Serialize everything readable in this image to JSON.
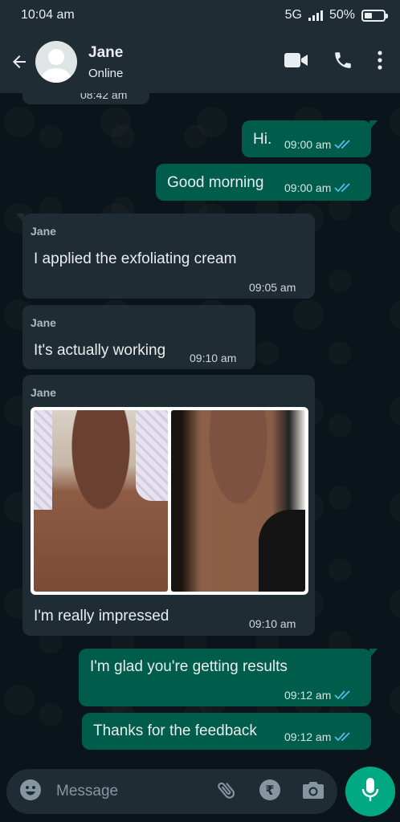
{
  "status_bar": {
    "time": "10:04 am",
    "network": "5G",
    "battery": "50%",
    "battery_level": 0.5
  },
  "header": {
    "name": "Jane",
    "status": "Online"
  },
  "chat": {
    "partial_timestamp": "08:42 am",
    "messages": [
      {
        "direction": "out",
        "text": "Hi.",
        "time": "09:00 am"
      },
      {
        "direction": "out",
        "text": "Good morning",
        "time": "09:00 am"
      },
      {
        "direction": "in",
        "sender": "Jane",
        "text": "I applied the exfoliating cream",
        "time": "09:05 am"
      },
      {
        "direction": "in",
        "sender": "Jane",
        "text": "It's actually working",
        "time": "09:10 am"
      },
      {
        "direction": "in",
        "sender": "Jane",
        "text": "I'm really impressed",
        "time": "09:10 am",
        "has_image": true
      },
      {
        "direction": "out",
        "text": "I'm glad you're getting results",
        "time": "09:12 am"
      },
      {
        "direction": "out",
        "text": "Thanks for the feedback",
        "time": "09:12 am"
      }
    ]
  },
  "input": {
    "placeholder": "Message"
  },
  "colors": {
    "incoming": "#1f2c34",
    "outgoing": "#005c4b",
    "accent": "#00a884",
    "read_ticks": "#53bdeb"
  },
  "icons": [
    "back-arrow-icon",
    "video-call-icon",
    "phone-icon",
    "more-options-icon",
    "emoji-icon",
    "attach-icon",
    "rupee-payment-icon",
    "camera-icon",
    "mic-icon",
    "double-check-icon"
  ]
}
